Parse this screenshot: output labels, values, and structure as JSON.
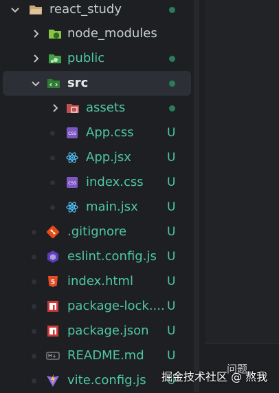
{
  "root": {
    "label": "react_study"
  },
  "items": [
    {
      "label": "node_modules",
      "status": ""
    },
    {
      "label": "public",
      "status": ""
    },
    {
      "label": "src",
      "status": ""
    },
    {
      "label": "assets",
      "status": ""
    },
    {
      "label": "App.css",
      "status": "U"
    },
    {
      "label": "App.jsx",
      "status": "U"
    },
    {
      "label": "index.css",
      "status": "U"
    },
    {
      "label": "main.jsx",
      "status": "U"
    },
    {
      "label": ".gitignore",
      "status": "U"
    },
    {
      "label": "eslint.config.js",
      "status": "U"
    },
    {
      "label": "index.html",
      "status": "U"
    },
    {
      "label": "package-lock....",
      "status": "U"
    },
    {
      "label": "package.json",
      "status": "U"
    },
    {
      "label": "README.md",
      "status": "U"
    },
    {
      "label": "vite.config.js",
      "status": "U"
    }
  ],
  "bottom_panel": {
    "tab_label": "问题"
  },
  "watermark": "掘金技术社区 @ 熬我",
  "colors": {
    "untracked": "#4ec9a0",
    "background": "#1e1f22",
    "active_row": "#2c2f35"
  }
}
